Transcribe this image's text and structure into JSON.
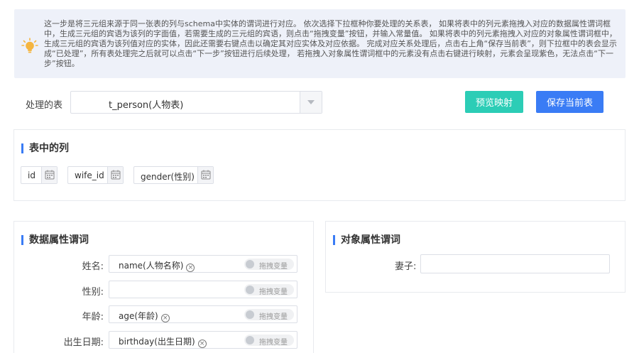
{
  "notice": {
    "icon": "lightbulb-icon",
    "text": "这一步是将三元组来源于同一张表的列与schema中实体的谓词进行对应。 依次选择下拉框种你要处理的关系表， 如果将表中的列元素拖拽入对应的数据属性谓词框中，生成三元组的宾语为该列的字面值，若需要生成的三元组的宾语，则点击“拖拽变量”按钮，并输入常量值。 如果将表中的列元素拖拽入对应的对象属性谓词框中，生成三元组的宾语为该列值对应的实体，因此还需要右键点击以确定其对应实体及对应依据。 完成对应关系处理后，点击右上角“保存当前表”，则下拉框中的表会显示成“已处理”，所有表处理完之后就可以点击“下一步”按钮进行后续处理， 若拖拽入对象属性谓词框中的元素没有点击右键进行映射，元素会呈现紫色，无法点击“下一步”按钮。"
  },
  "table_select": {
    "label": "处理的表",
    "value": "t_person(人物表)"
  },
  "buttons": {
    "preview": "预览映射",
    "save": "保存当前表"
  },
  "columns_panel": {
    "title": "表中的列",
    "columns": [
      "id",
      "wife_id",
      "gender(性别)"
    ]
  },
  "data_props": {
    "title": "数据属性谓词",
    "toggle_label": "拖拽变量",
    "rows": [
      {
        "label": "姓名:",
        "value": "name(人物名称)"
      },
      {
        "label": "性别:",
        "value": ""
      },
      {
        "label": "年龄:",
        "value": "age(年龄)"
      },
      {
        "label": "出生日期:",
        "value": "birthday(出生日期)"
      }
    ]
  },
  "object_props": {
    "title": "对象属性谓词",
    "rows": [
      {
        "label": "妻子:",
        "value": ""
      }
    ]
  },
  "colors": {
    "primary": "#3a7cf5",
    "teal": "#2ccdb6",
    "notice_bg": "#eef1f9",
    "bulb": "#f5b53f"
  }
}
